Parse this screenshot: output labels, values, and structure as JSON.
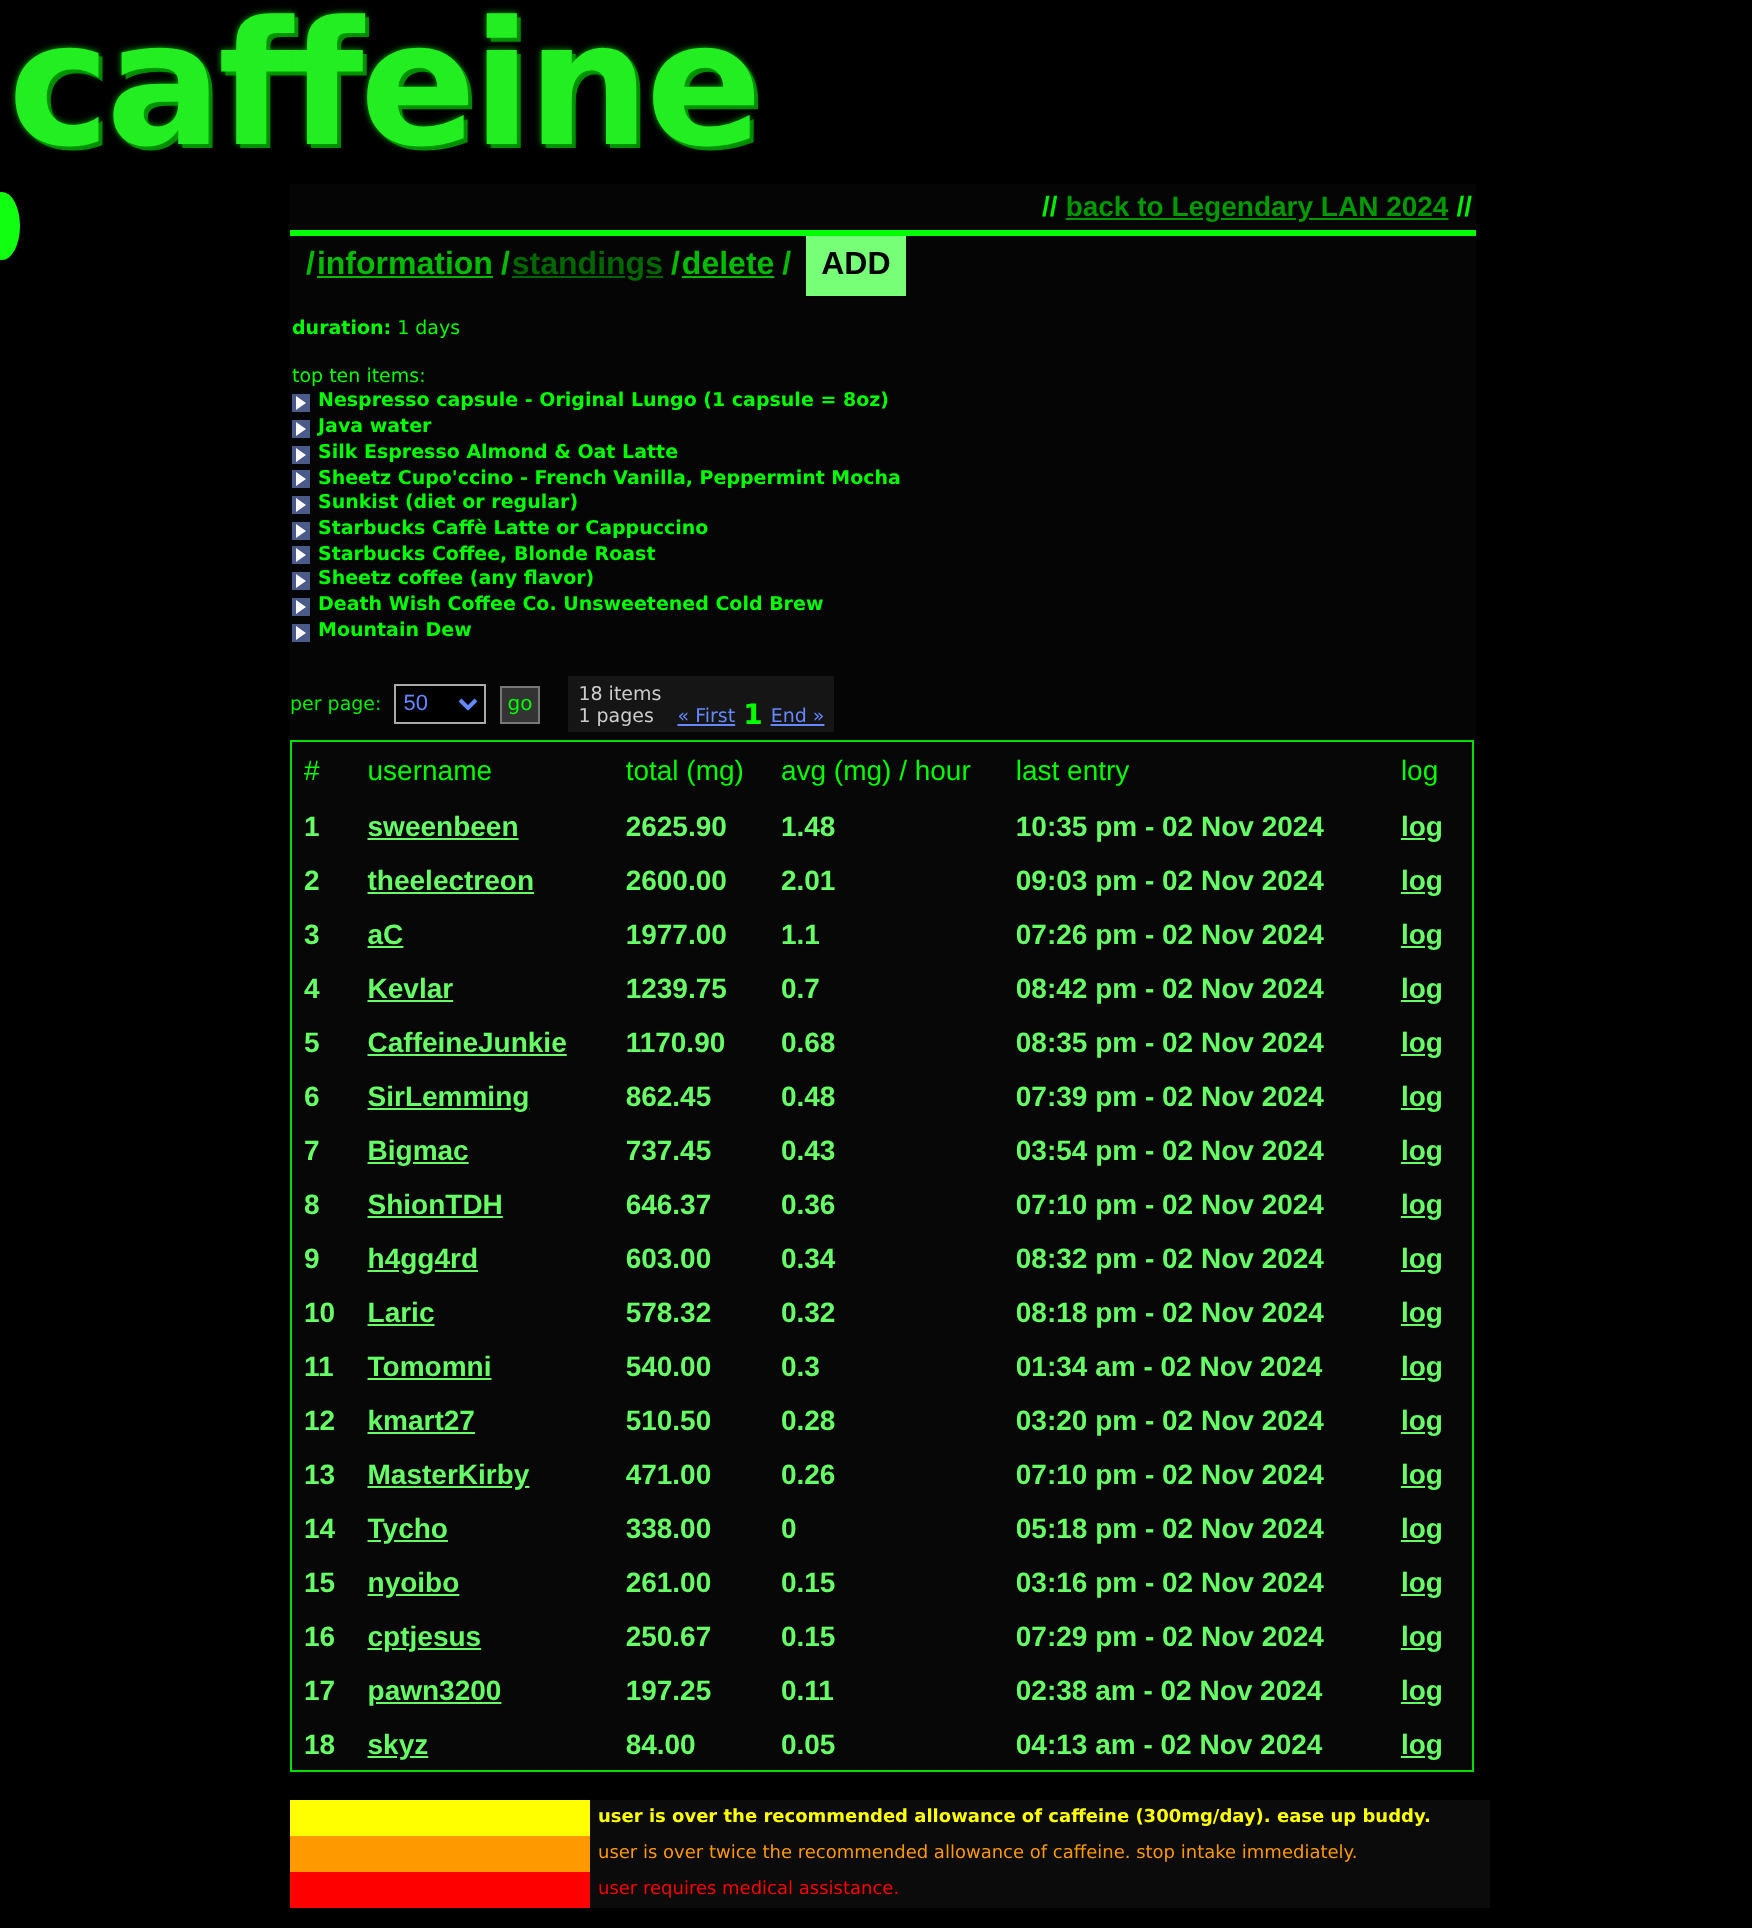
{
  "logo": {
    "text": "caffeine"
  },
  "header": {
    "back_link": "back to Legendary LAN 2024",
    "slashes_left": "//",
    "slashes_right": "//"
  },
  "nav": [
    {
      "prefix": "/",
      "label": "information",
      "selected": false,
      "kind": "link"
    },
    {
      "prefix": "/",
      "label": "standings",
      "selected": true,
      "kind": "link"
    },
    {
      "prefix": "/",
      "label": "delete",
      "suffix": "/",
      "selected": false,
      "kind": "link"
    },
    {
      "label": "ADD",
      "selected": false,
      "kind": "button"
    }
  ],
  "duration": {
    "label": "duration:",
    "value": "1 days"
  },
  "top_items": {
    "title": "top ten items:",
    "items": [
      "Nespresso capsule - Original Lungo (1 capsule = 8oz)",
      "Java water",
      "Silk Espresso Almond & Oat Latte",
      "Sheetz Cupo'ccino - French Vanilla, Peppermint Mocha",
      "Sunkist (diet or regular)",
      "Starbucks Caffè Latte or Cappuccino",
      "Starbucks Coffee, Blonde Roast",
      "Sheetz coffee (any flavor)",
      "Death Wish Coffee Co. Unsweetened Cold Brew",
      "Mountain Dew"
    ]
  },
  "pager": {
    "per_page_label": "per page:",
    "per_page_value": "50",
    "go": "go",
    "items": "18 items",
    "pages": "1 pages",
    "first": "« First",
    "current": "1",
    "end": "End »"
  },
  "table": {
    "columns": [
      "#",
      "username",
      "total (mg)",
      "avg (mg) / hour",
      "last entry",
      "log"
    ],
    "rows": [
      [
        "1",
        "sweenbeen",
        "2625.90",
        "1.48",
        "10:35 pm - 02 Nov 2024",
        "log"
      ],
      [
        "2",
        "theelectreon",
        "2600.00",
        "2.01",
        "09:03 pm - 02 Nov 2024",
        "log"
      ],
      [
        "3",
        "aC",
        "1977.00",
        "1.1",
        "07:26 pm - 02 Nov 2024",
        "log"
      ],
      [
        "4",
        "Kevlar",
        "1239.75",
        "0.7",
        "08:42 pm - 02 Nov 2024",
        "log"
      ],
      [
        "5",
        "CaffeineJunkie",
        "1170.90",
        "0.68",
        "08:35 pm - 02 Nov 2024",
        "log"
      ],
      [
        "6",
        "SirLemming",
        "862.45",
        "0.48",
        "07:39 pm - 02 Nov 2024",
        "log"
      ],
      [
        "7",
        "Bigmac",
        "737.45",
        "0.43",
        "03:54 pm - 02 Nov 2024",
        "log"
      ],
      [
        "8",
        "ShionTDH",
        "646.37",
        "0.36",
        "07:10 pm - 02 Nov 2024",
        "log"
      ],
      [
        "9",
        "h4gg4rd",
        "603.00",
        "0.34",
        "08:32 pm - 02 Nov 2024",
        "log"
      ],
      [
        "10",
        "Laric",
        "578.32",
        "0.32",
        "08:18 pm - 02 Nov 2024",
        "log"
      ],
      [
        "11",
        "Tomomni",
        "540.00",
        "0.3",
        "01:34 am - 02 Nov 2024",
        "log"
      ],
      [
        "12",
        "kmart27",
        "510.50",
        "0.28",
        "03:20 pm - 02 Nov 2024",
        "log"
      ],
      [
        "13",
        "MasterKirby",
        "471.00",
        "0.26",
        "07:10 pm - 02 Nov 2024",
        "log"
      ],
      [
        "14",
        "Tycho",
        "338.00",
        "0",
        "05:18 pm - 02 Nov 2024",
        "log"
      ],
      [
        "15",
        "nyoibo",
        "261.00",
        "0.15",
        "03:16 pm - 02 Nov 2024",
        "log"
      ],
      [
        "16",
        "cptjesus",
        "250.67",
        "0.15",
        "07:29 pm - 02 Nov 2024",
        "log"
      ],
      [
        "17",
        "pawn3200",
        "197.25",
        "0.11",
        "02:38 am - 02 Nov 2024",
        "log"
      ],
      [
        "18",
        "skyz",
        "84.00",
        "0.05",
        "04:13 am - 02 Nov 2024",
        "log"
      ]
    ]
  },
  "legend": [
    {
      "text": "user is over the recommended allowance of caffeine (300mg/day). ease up buddy.",
      "color": "#ffff00",
      "bold": true
    },
    {
      "text": "user is over twice the recommended allowance of caffeine. stop intake immediately.",
      "color": "#ff9900",
      "bold": false
    },
    {
      "text": "user requires medical assistance.",
      "color": "#ff0000",
      "bold": false
    }
  ]
}
